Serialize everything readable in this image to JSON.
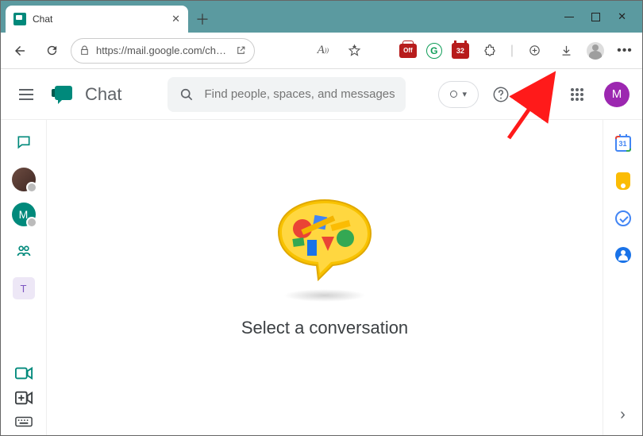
{
  "browser": {
    "tab_title": "Chat",
    "url": "https://mail.google.com/ch…",
    "extensions": {
      "off_label": "Off",
      "calendar_badge": "32"
    }
  },
  "header": {
    "app_title": "Chat",
    "search_placeholder": "Find people, spaces, and messages",
    "avatar_initial": "M"
  },
  "left_rail": {
    "user2_initial": "M",
    "space_initial": "T"
  },
  "main": {
    "empty_state_text": "Select a conversation"
  },
  "right_rail": {
    "calendar_day": "31"
  },
  "annotation": {
    "target": "settings-gear"
  }
}
